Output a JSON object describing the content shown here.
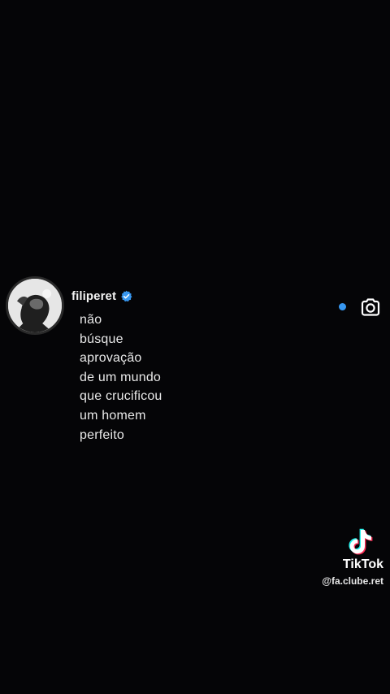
{
  "post": {
    "username": "filiperet",
    "verified": true,
    "message_lines": [
      "não",
      "búsque",
      "aprovação",
      "de um mundo",
      "que crucificou",
      "um homem",
      "perfeito"
    ]
  },
  "icons": {
    "avatar": "profile-photo",
    "verified": "verified-badge-icon",
    "unread": "unread-dot",
    "camera": "camera-icon",
    "brand": "tiktok-logo-icon"
  },
  "watermark": {
    "brand": "TikTok",
    "handle": "@fa.clube.ret"
  },
  "colors": {
    "background": "#050507",
    "accent": "#3797f0",
    "text": "#e9e9e9"
  }
}
